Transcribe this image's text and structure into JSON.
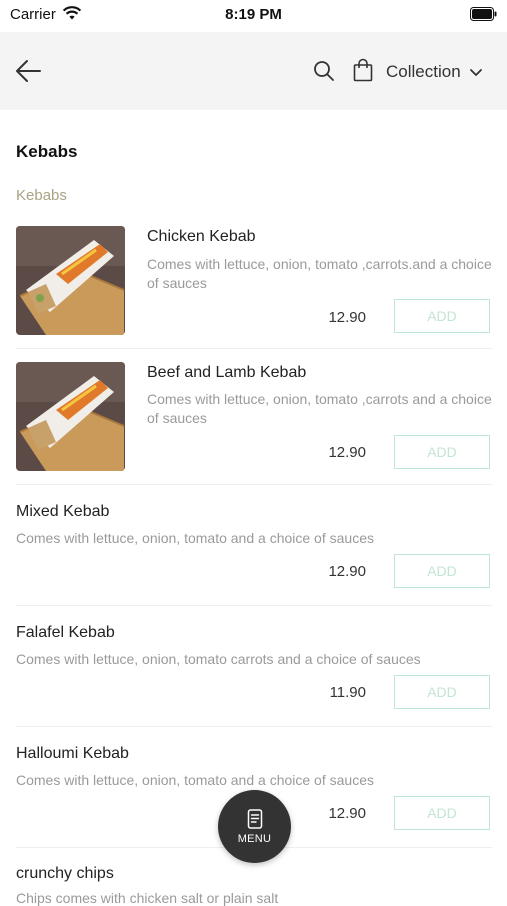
{
  "status_bar": {
    "carrier": "Carrier",
    "time": "8:19 PM"
  },
  "header": {
    "collection_label": "Collection"
  },
  "section": {
    "title": "Kebabs",
    "category": "Kebabs"
  },
  "items": [
    {
      "name": "Chicken Kebab",
      "description": "Comes with lettuce, onion, tomato ,carrots.and a choice of sauces",
      "price": "12.90",
      "add_label": "ADD"
    },
    {
      "name": "Beef and Lamb Kebab",
      "description": "Comes with lettuce, onion, tomato ,carrots and a choice of sauces",
      "price": "12.90",
      "add_label": "ADD"
    },
    {
      "name": "Mixed Kebab",
      "description": "Comes with lettuce, onion, tomato and a choice of sauces",
      "price": "12.90",
      "add_label": "ADD"
    },
    {
      "name": "Falafel Kebab",
      "description": "Comes with lettuce, onion, tomato carrots and a choice of sauces",
      "price": "11.90",
      "add_label": "ADD"
    },
    {
      "name": "Halloumi Kebab",
      "description": "Comes with lettuce, onion, tomato and a choice of sauces",
      "price": "12.90",
      "add_label": "ADD"
    },
    {
      "name": "crunchy chips",
      "description": "Chips comes with chicken salt or plain salt"
    }
  ],
  "menu_button": {
    "label": "MENU"
  },
  "colors": {
    "accent_green": "#bfe6d0",
    "category_tan": "#a9a283",
    "fab_dark": "#333333",
    "header_bg": "#f4f4f4"
  },
  "icons": [
    "wifi-icon",
    "battery-icon",
    "back-arrow-icon",
    "search-icon",
    "shopping-bag-icon",
    "chevron-down-icon",
    "menu-icon"
  ]
}
